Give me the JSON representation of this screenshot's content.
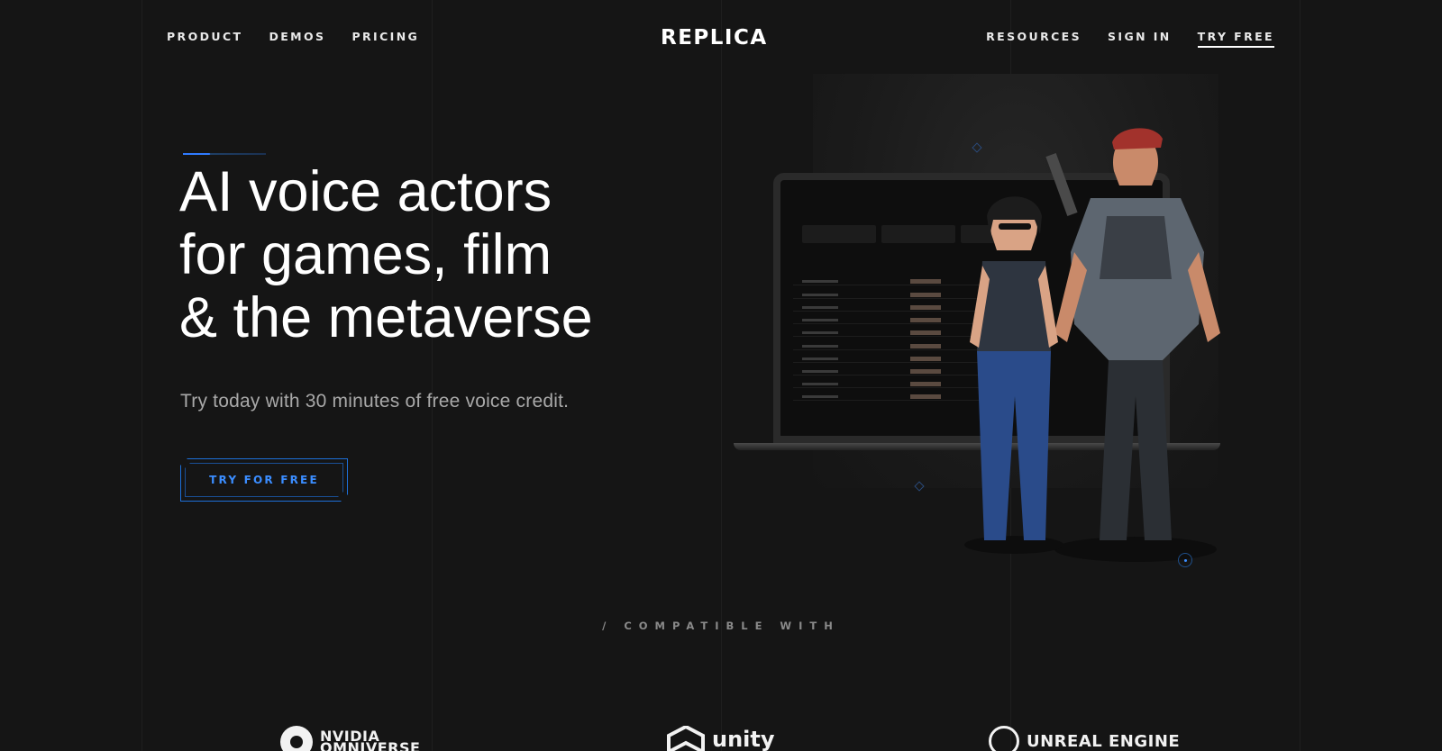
{
  "nav": {
    "left": [
      {
        "label": "PRODUCT"
      },
      {
        "label": "DEMOS"
      },
      {
        "label": "PRICING"
      }
    ],
    "logo": "REPLICA",
    "right": [
      {
        "label": "RESOURCES"
      },
      {
        "label": "SIGN IN"
      },
      {
        "label": "TRY FREE"
      }
    ]
  },
  "hero": {
    "headline_lines": [
      "AI voice actors",
      "for games, film",
      "& the metaverse"
    ],
    "subtext": "Try today with 30 minutes of free voice credit.",
    "cta_label": "TRY FOR FREE"
  },
  "compatible": {
    "label": "/ COMPATIBLE WITH",
    "partners": [
      {
        "name": "NVIDIA",
        "name_line2": "OMNIVERSE",
        "icon": "nvidia-omniverse-logo-icon"
      },
      {
        "name": "unity",
        "icon": "unity-logo-icon"
      },
      {
        "name": "UNREAL ENGINE",
        "icon": "unreal-engine-logo-icon"
      }
    ]
  },
  "colors": {
    "background": "#151515",
    "accent": "#2f7bff",
    "text_primary": "#ffffff",
    "text_muted": "#a9a9a9"
  }
}
